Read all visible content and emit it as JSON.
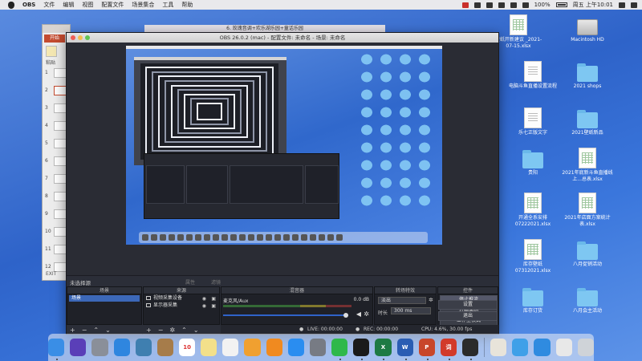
{
  "menubar": {
    "app": "OBS",
    "items": [
      "文件",
      "编辑",
      "视图",
      "配置文件",
      "场景集合",
      "工具",
      "帮助"
    ],
    "battery": "100%",
    "datetime": "周五 上午10:01"
  },
  "desktop_icons": [
    {
      "label": "壁纸开新建议\n_2021-07-15.xlsx",
      "type": "xls"
    },
    {
      "label": "Macintosh HD",
      "type": "hd"
    },
    {
      "label": "电脑斗鱼直播设置流程",
      "type": "doc"
    },
    {
      "label": "2021 shops",
      "type": "folder"
    },
    {
      "label": "乐七正版文字",
      "type": "doc"
    },
    {
      "label": "2021壁纸新品",
      "type": "folder"
    },
    {
      "label": "贵阳",
      "type": "folder"
    },
    {
      "label": "2021年底新斗鱼直播线上...总表.xlsx",
      "type": "xls"
    },
    {
      "label": "开通全系安排07222021.xlsx",
      "type": "xls"
    },
    {
      "label": "2021年店面方案统计表.xlsx",
      "type": "xls"
    },
    {
      "label": "库存壁纸07312021.xlsx",
      "type": "xls"
    },
    {
      "label": "八月促销活动",
      "type": "folder"
    },
    {
      "label": "库存订货",
      "type": "folder"
    },
    {
      "label": "八月会主活动",
      "type": "folder"
    }
  ],
  "keynote": {
    "tab": "开始",
    "paste": "粘贴",
    "title": "6. 玫瑰音调+欢乐湖乐园+童话乐园",
    "slide_numbers": [
      "1",
      "2",
      "3",
      "4",
      "5",
      "6",
      "7",
      "8",
      "9",
      "10",
      "11",
      "12"
    ],
    "exit": "EXIT"
  },
  "obs": {
    "title": "OBS 26.0.2 (mac) - 配置文件: 未命名 - 场景: 未命名",
    "no_source": "未选择源",
    "properties": "属性",
    "filters": "滤镜",
    "scenes_header": "场景",
    "scenes": [
      "场景"
    ],
    "sources_header": "来源",
    "sources": [
      {
        "name": "视频采集设备"
      },
      {
        "name": "显示器采集"
      }
    ],
    "mixer_header": "混音器",
    "mixer": {
      "channel": "麦克风/Aux",
      "db": "0.0 dB"
    },
    "transitions_header": "转场特效",
    "transition": "淡出",
    "duration_label": "时长",
    "duration": "300 ms",
    "controls_header": "控件",
    "controls": [
      "停止推流",
      "开始录制",
      "工作室模式",
      "设置",
      "退出"
    ],
    "status": {
      "live": "LIVE: 00:00:00",
      "rec": "REC: 00:00:00",
      "cpu": "CPU: 4.6%, 30.00 fps"
    },
    "footer_icons": [
      "add-icon",
      "remove-icon",
      "move-up-icon",
      "move-down-icon",
      "gear-icon"
    ]
  },
  "dock": {
    "apps": [
      {
        "name": "finder-icon",
        "color": "#3a8ee6"
      },
      {
        "name": "siri-icon",
        "color": "#5a3fb8"
      },
      {
        "name": "launchpad-icon",
        "color": "#8a8f99"
      },
      {
        "name": "safari-icon",
        "color": "#2f86df"
      },
      {
        "name": "photos-booth-icon",
        "color": "#3f7fb0"
      },
      {
        "name": "notes-book-icon",
        "color": "#a67c4a"
      },
      {
        "name": "calendar-icon",
        "color": "#ffffff",
        "text": "10"
      },
      {
        "name": "notes-icon",
        "color": "#f3e08a"
      },
      {
        "name": "reminders-icon",
        "color": "#f2f2f2"
      },
      {
        "name": "photos-icon",
        "color": "#f0a030"
      },
      {
        "name": "books-icon",
        "color": "#f08a20"
      },
      {
        "name": "app-store-icon",
        "color": "#2a8df0"
      },
      {
        "name": "system-preferences-icon",
        "color": "#777b84"
      },
      {
        "name": "wechat-icon",
        "color": "#2fb84a"
      },
      {
        "name": "qq-icon",
        "color": "#1a1a1a"
      },
      {
        "name": "excel-icon",
        "color": "#1e7a43",
        "text": "X"
      },
      {
        "name": "word-icon",
        "color": "#2a5db3",
        "text": "W"
      },
      {
        "name": "powerpoint-icon",
        "color": "#c8462a",
        "text": "P"
      },
      {
        "name": "youdao-icon",
        "color": "#d23a2a",
        "text": "词"
      },
      {
        "name": "obs-icon",
        "color": "#2b2b2b"
      },
      {
        "name": "preview-icon",
        "color": "#e8e4da"
      },
      {
        "name": "mail-send-icon",
        "color": "#3fa0e8"
      },
      {
        "name": "link-app-icon",
        "color": "#2f8be0"
      },
      {
        "name": "cloud-icon",
        "color": "#e8e8e8"
      },
      {
        "name": "trash-icon",
        "color": "#cfd3d8"
      }
    ]
  }
}
